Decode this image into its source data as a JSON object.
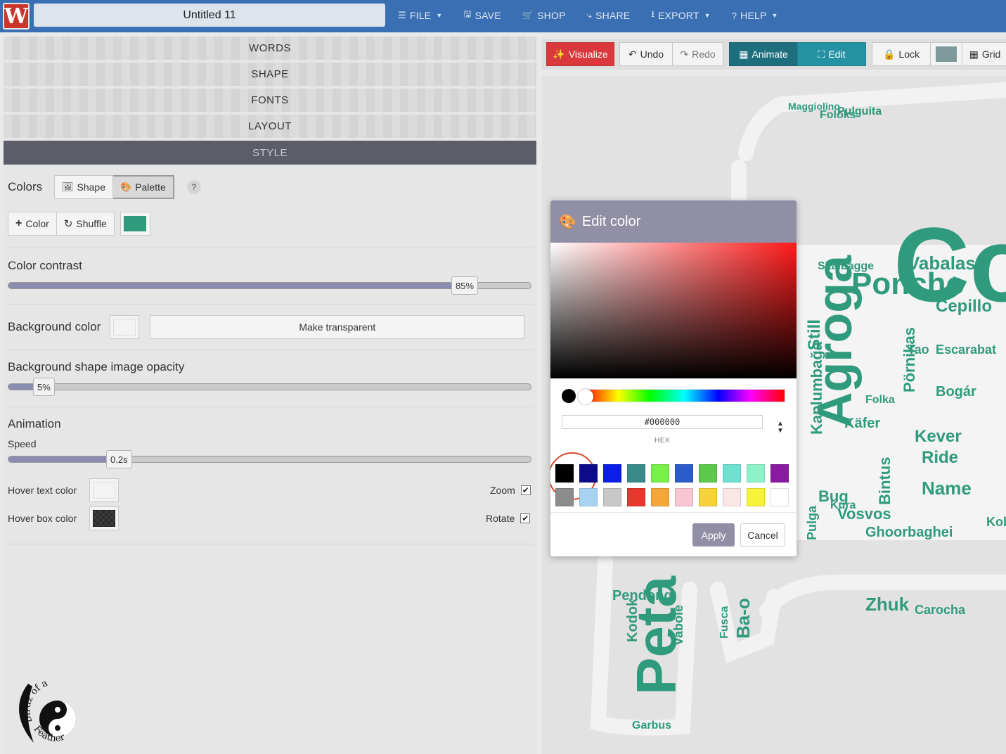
{
  "app": {
    "logo_letter": "W",
    "doc_title": "Untitled 11"
  },
  "menu": [
    {
      "label": "FILE",
      "icon": "hamburger-icon",
      "glyph": "☰",
      "caret": true
    },
    {
      "label": "SAVE",
      "icon": "save-icon",
      "glyph": "🖫",
      "caret": false
    },
    {
      "label": "SHOP",
      "icon": "cart-icon",
      "glyph": "🛒",
      "caret": false
    },
    {
      "label": "SHARE",
      "icon": "share-icon",
      "glyph": "⤷",
      "caret": false
    },
    {
      "label": "EXPORT",
      "icon": "download-icon",
      "glyph": "⭳",
      "caret": true
    },
    {
      "label": "HELP",
      "icon": "question-icon",
      "glyph": "?",
      "caret": true
    }
  ],
  "sections": [
    "WORDS",
    "SHAPE",
    "FONTS",
    "LAYOUT",
    "STYLE"
  ],
  "active_section": "STYLE",
  "style": {
    "colors_label": "Colors",
    "shape_btn": "Shape",
    "palette_btn": "Palette",
    "help_q": "?",
    "add_color_btn": "Color",
    "shuffle_btn": "Shuffle",
    "palette_swatch": "#2f9a7c",
    "contrast_label": "Color contrast",
    "contrast_value": "85%",
    "contrast_fraction": 0.85,
    "bg_label": "Background color",
    "make_transparent": "Make transparent",
    "bg_opacity_label": "Background shape image opacity",
    "bg_opacity_value": "5%",
    "bg_opacity_fraction": 0.05,
    "animation_label": "Animation",
    "speed_label": "Speed",
    "speed_value": "0.2s",
    "speed_fraction": 0.19,
    "hover_text_label": "Hover text color",
    "hover_box_label": "Hover box color",
    "zoom_label": "Zoom",
    "rotate_label": "Rotate"
  },
  "toolbar": {
    "visualize": "Visualize",
    "undo": "Undo",
    "redo": "Redo",
    "animate": "Animate",
    "edit": "Edit",
    "lock": "Lock",
    "grid": "Grid"
  },
  "modal": {
    "title": "Edit color",
    "hex_value": "#000000",
    "hex_label": "HEX",
    "apply": "Apply",
    "cancel": "Cancel",
    "swatches": [
      [
        "#000000",
        "#0b0b8c",
        "#0a1ee6",
        "#3b8a8a",
        "#78f04a",
        "#2b5cc9",
        "#5cc84c",
        "#6fe0d2",
        "#8ef2c8",
        "#8a1aa0"
      ],
      [
        "#8c8c8c",
        "#a6d4f0",
        "#c8c8c8",
        "#e8372c",
        "#f4a63a",
        "#f7c6d2",
        "#f7d23c",
        "#fbe6e6",
        "#f7f33a",
        "#ffffff"
      ]
    ]
  },
  "watermark": {
    "text_top": "Birdz of a",
    "text_bottom": "Feather"
  },
  "word_cloud": {
    "color": "#2f9a7c",
    "words": [
      "Con",
      "Agroga",
      "Poncho",
      "Peta",
      "Vabalas",
      "Cepillo",
      "Zhuk",
      "Ride",
      "Name",
      "Bogár",
      "Escarabat",
      "Kever",
      "Ghoorbaghei",
      "Pulguita",
      "Foloks",
      "Skalbagge",
      "Kaplumbağa",
      "Pörnikas",
      "Käfer",
      "Bintus",
      "Vosvos",
      "Kura",
      "Bug",
      "Pendong",
      "Kodok",
      "Garbus",
      "Vabole",
      "Ba-o",
      "Fusca",
      "Carocha",
      "Maggiolino",
      "Pulga",
      "Tao",
      "Still",
      "Folka",
      "Kobe"
    ]
  }
}
